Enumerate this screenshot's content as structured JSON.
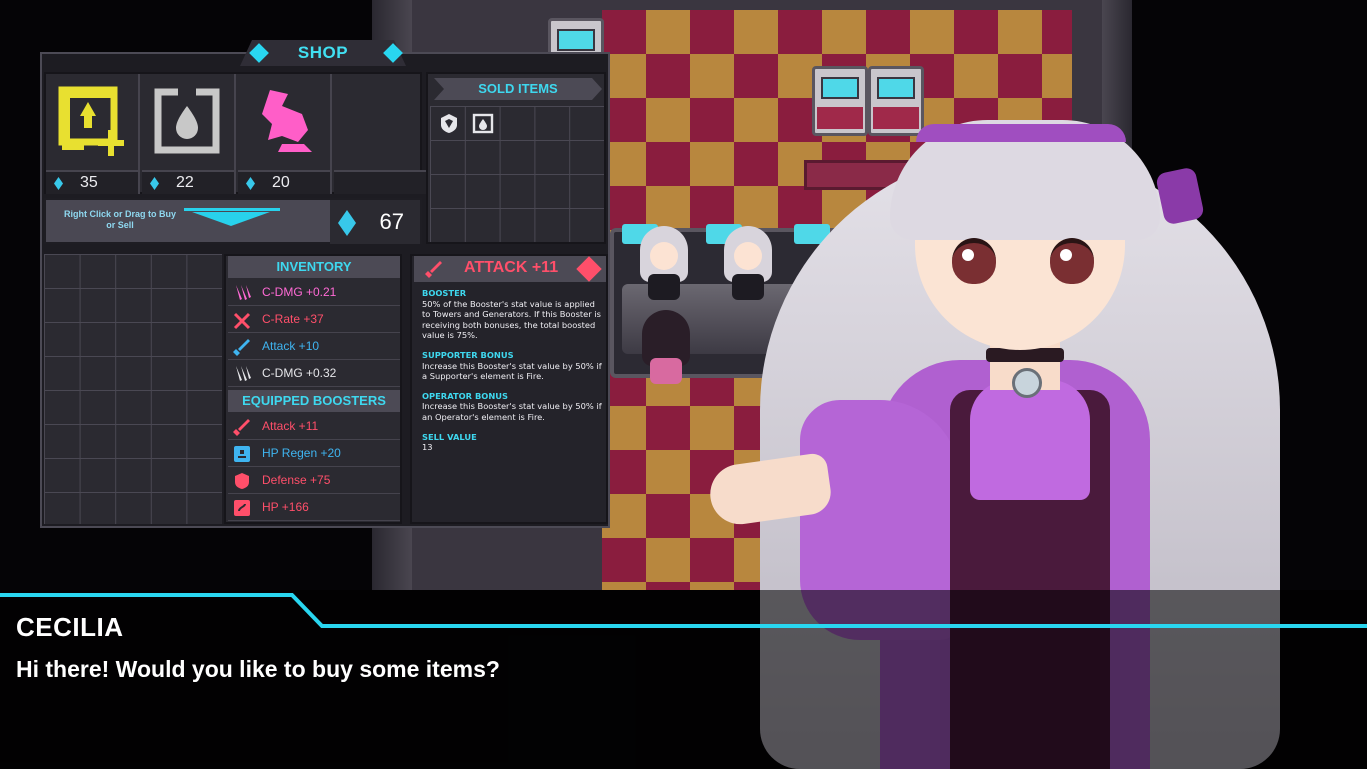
{
  "shop": {
    "title": "SHOP",
    "items": [
      {
        "icon": "attack-speed-booster-icon",
        "price": "35",
        "color": "#e8e030"
      },
      {
        "icon": "defense-booster-icon",
        "price": "22",
        "color": "#c8c8c8"
      },
      {
        "icon": "attack-crystal-icon",
        "price": "20",
        "color": "#ff5ec8"
      }
    ],
    "hint": "Right Click or Drag to Buy or Sell",
    "currency": "67"
  },
  "sold_items": {
    "title": "SOLD ITEMS",
    "icons": [
      "defense-shield-icon",
      "defense-booster-icon"
    ]
  },
  "inventory": {
    "title": "INVENTORY",
    "rows": [
      {
        "label": "C-DMG +0.21",
        "color": "#ff6ad5",
        "icon": "crit-damage-icon"
      },
      {
        "label": "C-Rate +37",
        "color": "#ff4f6a",
        "icon": "crit-rate-icon"
      },
      {
        "label": "Attack +10",
        "color": "#3fb4f0",
        "icon": "attack-icon"
      },
      {
        "label": "C-DMG +0.32",
        "color": "#e6e6ea",
        "icon": "crit-damage-icon"
      }
    ]
  },
  "equipped": {
    "title": "EQUIPPED BOOSTERS",
    "rows": [
      {
        "label": "Attack +11",
        "color": "#ff4f6a",
        "icon": "attack-icon"
      },
      {
        "label": "HP Regen +20",
        "color": "#3fb4f0",
        "icon": "hp-regen-icon"
      },
      {
        "label": "Defense +75",
        "color": "#ff4f6a",
        "icon": "defense-shield-icon"
      },
      {
        "label": "HP +166",
        "color": "#ff4f6a",
        "icon": "hp-icon"
      }
    ]
  },
  "detail": {
    "title": "ATTACK +11",
    "booster_head": "BOOSTER",
    "booster_text": "50% of the Booster's stat value is applied to Towers and Generators. If this Booster is receiving both bonuses, the total boosted value is 75%.",
    "supporter_head": "SUPPORTER BONUS",
    "supporter_text": "Increase this Booster's stat value by 50% if a Supporter's element is Fire.",
    "operator_head": "OPERATOR BONUS",
    "operator_text": "Increase this Booster's stat value by 50% if an Operator's element is Fire.",
    "sell_head": "SELL VALUE",
    "sell_value": "13"
  },
  "dialogue": {
    "speaker": "CECILIA",
    "line": "Hi there! Would you like to buy some items?"
  },
  "colors": {
    "accent": "#29d6f0",
    "panel": "#2f2d36"
  }
}
